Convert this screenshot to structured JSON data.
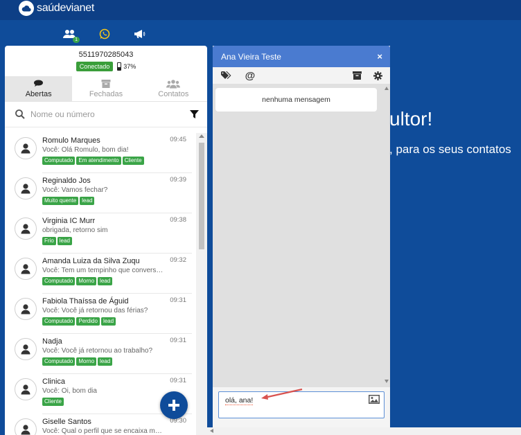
{
  "app": {
    "logo_text": "saúdevianet"
  },
  "top_icons": {
    "contacts_badge": "1"
  },
  "background": {
    "title": "ultor!",
    "subtitle": ", para os seus contatos"
  },
  "account": {
    "phone": "5511970285043",
    "status": "Conectado",
    "battery": "37%"
  },
  "tabs": [
    {
      "label": "Abertas",
      "icon": "chat-icon",
      "active": true
    },
    {
      "label": "Fechadas",
      "icon": "archive-icon",
      "active": false
    },
    {
      "label": "Contatos",
      "icon": "users-icon",
      "active": false
    }
  ],
  "search": {
    "placeholder": "Nome ou número"
  },
  "conversations": [
    {
      "name": "Romulo Marques",
      "time": "09:45",
      "message": "Você: Olá Romulo, bom dia!",
      "tags": [
        "Computado",
        "Em atendimento",
        "Cliente"
      ]
    },
    {
      "name": "Reginaldo Jos",
      "time": "09:39",
      "message": "Você: Vamos fechar?",
      "tags": [
        "Muito quente",
        "lead"
      ]
    },
    {
      "name": "Virginia IC Murr",
      "time": "09:38",
      "message": "obrigada, retorno sim",
      "tags": [
        "Frio",
        "lead"
      ]
    },
    {
      "name": "Amanda Luiza da Silva Zuqu",
      "time": "09:32",
      "message": "Você: Tem um tempinho que convers…",
      "tags": [
        "Computado",
        "Morno",
        "lead"
      ]
    },
    {
      "name": "Fabiola Thaíssa de Águid",
      "time": "09:31",
      "message": "Você: Você já retornou das férias?",
      "tags": [
        "Computado",
        "Perdido",
        "lead"
      ]
    },
    {
      "name": "Nadja",
      "time": "09:31",
      "message": "Você: Você já retornou ao trabalho?",
      "tags": [
        "Computado",
        "Morno",
        "lead"
      ]
    },
    {
      "name": "Clinica",
      "time": "09:31",
      "message": "Você: Oi, bom dia",
      "tags": [
        "Cliente"
      ]
    },
    {
      "name": "Giselle Santos",
      "time": "09:30",
      "message": "Você: Qual o perfil que se encaixa m…",
      "tags": []
    }
  ],
  "chat": {
    "title": "Ana Vieira Teste",
    "close": "×",
    "empty_text": "nenhuma mensagem",
    "input_value": "olá, ana!"
  },
  "colors": {
    "brand": "#0f4c9a",
    "header": "#4a7bd0",
    "tag": "#3aa447"
  }
}
